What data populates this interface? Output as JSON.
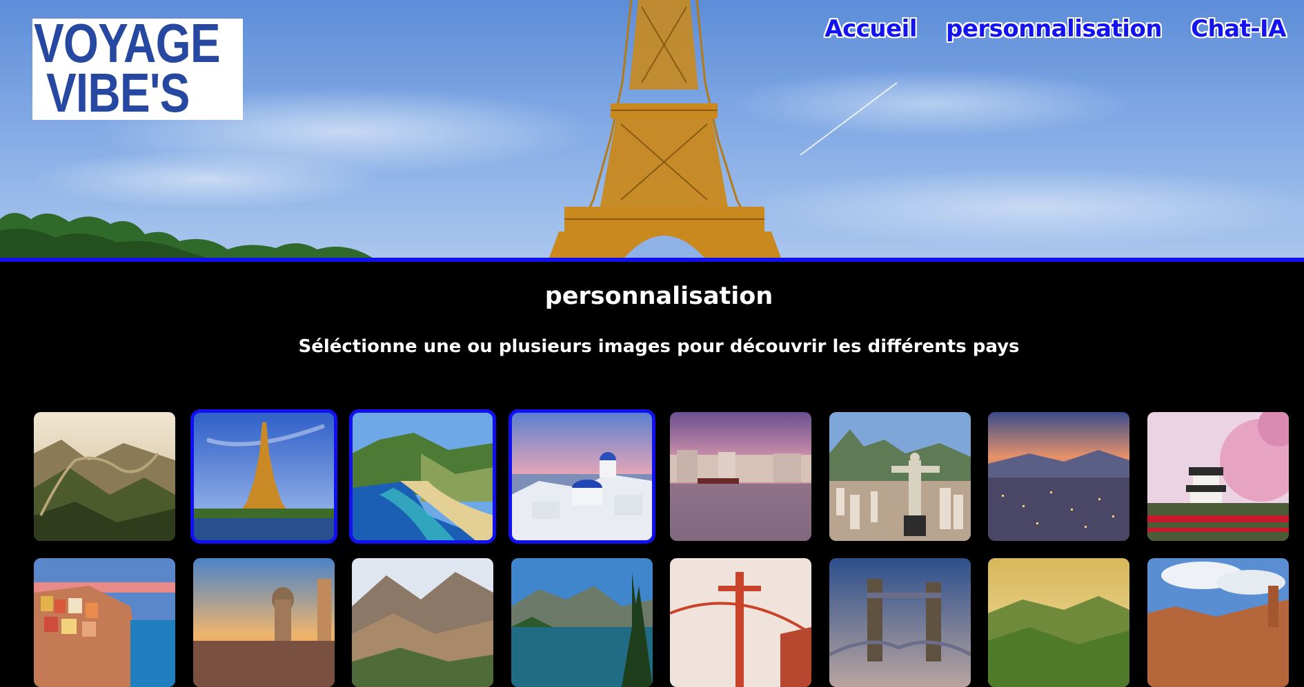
{
  "logo": {
    "line1": "VOYAGE",
    "line2": "VIBE'S"
  },
  "nav": {
    "items": [
      {
        "label": "Accueil"
      },
      {
        "label": "personnalisation"
      },
      {
        "label": "Chat-IA"
      }
    ]
  },
  "main": {
    "title": "personnalisation",
    "subtitle": "Séléctionne une ou plusieurs images pour découvrir les différents pays"
  },
  "gallery": {
    "tiles": [
      {
        "icon": "great-wall-image",
        "selected": false
      },
      {
        "icon": "eiffel-tower-image",
        "selected": true
      },
      {
        "icon": "tropical-beach-image",
        "selected": true
      },
      {
        "icon": "santorini-image",
        "selected": true
      },
      {
        "icon": "canal-city-image",
        "selected": false
      },
      {
        "icon": "christ-redeemer-image",
        "selected": false
      },
      {
        "icon": "city-sunset-image",
        "selected": false
      },
      {
        "icon": "japanese-castle-image",
        "selected": false
      },
      {
        "icon": "cinque-terre-image",
        "selected": false
      },
      {
        "icon": "cathedral-sunset-image",
        "selected": false
      },
      {
        "icon": "mountain-valley-image",
        "selected": false
      },
      {
        "icon": "lake-forest-image",
        "selected": false
      },
      {
        "icon": "golden-gate-image",
        "selected": false
      },
      {
        "icon": "tower-bridge-image",
        "selected": false
      },
      {
        "icon": "green-hills-image",
        "selected": false
      },
      {
        "icon": "red-canyon-image",
        "selected": false
      }
    ]
  },
  "colors": {
    "accent": "#1010ee",
    "nav_text": "#1414ee",
    "logo_text": "#2748a0",
    "background": "#000000"
  }
}
